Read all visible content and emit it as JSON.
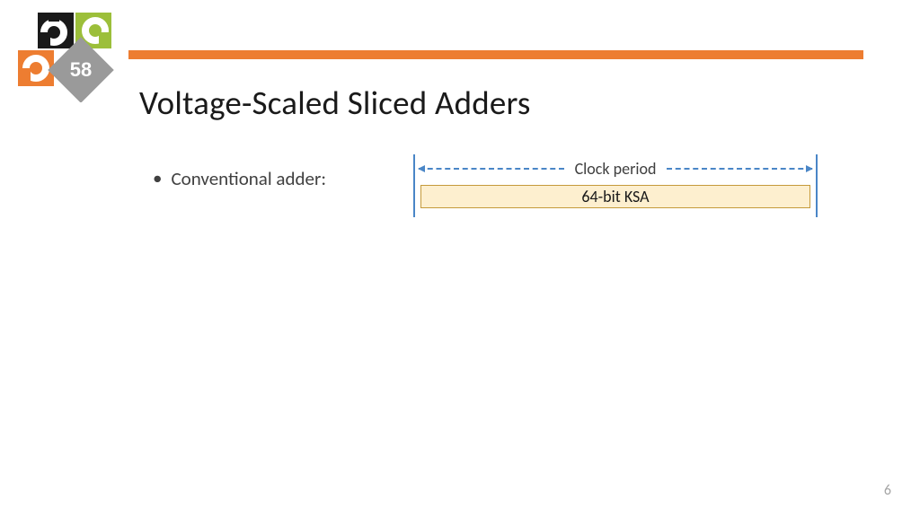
{
  "header": {
    "accent_color": "#ED7D31"
  },
  "logo": {
    "badge_text": "58"
  },
  "title": "Voltage-Scaled Sliced Adders",
  "bullets": [
    {
      "text": "Conventional adder:"
    }
  ],
  "diagram": {
    "clock_label": "Clock period",
    "bar_label": "64-bit KSA",
    "tick_color": "#4A86C7",
    "bar_fill": "#FDEFCF",
    "bar_border": "#C59A3B"
  },
  "page_number": "6"
}
